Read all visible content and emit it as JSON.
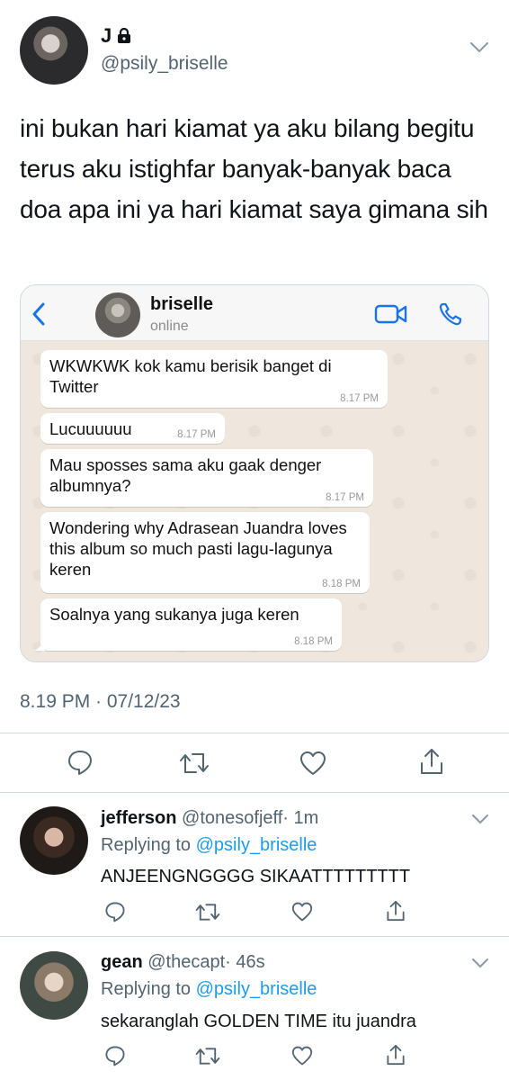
{
  "tweet": {
    "display_name": "J",
    "handle": "@psily_briselle",
    "text": "ini bukan hari kiamat ya aku bilang begitu terus aku istighfar banyak-banyak baca doa apa ini ya hari kiamat saya gimana sih",
    "timestamp": "8.19 PM · 07/12/23"
  },
  "chat": {
    "contact_name": "briselle",
    "status": "online",
    "messages": [
      {
        "text": "WKWKWK kok kamu berisik banget di Twitter",
        "time": "8.17 PM"
      },
      {
        "text": "Lucuuuuuu",
        "time": "8.17 PM"
      },
      {
        "text": "Mau sposses sama aku gaak denger albumnya?",
        "time": "8.17 PM"
      },
      {
        "text": "Wondering why Adrasean Juandra loves this album so much pasti lagu-lagunya keren",
        "time": "8.18 PM"
      },
      {
        "text": "Soalnya yang sukanya juga keren",
        "time": "8.18 PM"
      }
    ]
  },
  "replies": [
    {
      "name": "jefferson",
      "handle": "@tonesofjeff",
      "age": "· 1m",
      "replying_label": "Replying to",
      "replying_handle": "@psily_briselle",
      "text": "ANJEENGNGGGG SIKAATTTTTTTTT"
    },
    {
      "name": "gean",
      "handle": "@thecapt",
      "age": "· 46s",
      "replying_label": "Replying to",
      "replying_handle": "@psily_briselle",
      "text": "sekaranglah GOLDEN TIME itu juandra"
    }
  ],
  "colors": {
    "accent": "#1d9bf0",
    "secondary_text": "#536471",
    "chat_blue": "#1a73e8"
  }
}
